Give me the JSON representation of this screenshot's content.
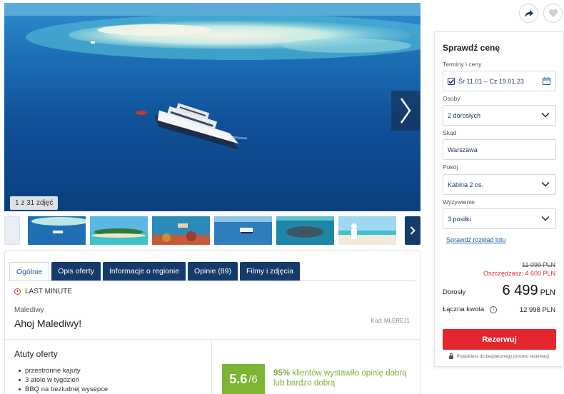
{
  "gallery": {
    "counter": "1 z 31 zdjęć",
    "thumbnails": [
      "boat-aerial",
      "island-beach",
      "snorkeling",
      "boat-sea",
      "dolphin",
      "woman-beach"
    ]
  },
  "tabs": [
    {
      "label": "Ogólnie",
      "active": true
    },
    {
      "label": "Opis oferty"
    },
    {
      "label": "Informacje o regionie"
    },
    {
      "label": "Opinie (89)"
    },
    {
      "label": "Filmy i zdjęcia"
    }
  ],
  "offer": {
    "badge": "LAST MINUTE",
    "region": "Malediwy",
    "title": "Ahoj Malediwy!",
    "code": "Kod: MLEREJ1"
  },
  "atuty": {
    "title": "Atuty oferty",
    "items": [
      "przestronne kajuty",
      "3 atole w tygdzień",
      "BBQ na bezludnej wysepce"
    ]
  },
  "rating": {
    "score": "5.6",
    "scale": "/6",
    "percent": "95%",
    "text": "klientów wystawiło opinię dobrą lub bardzo dobrą"
  },
  "booking": {
    "title": "Sprawdź cenę",
    "dates_label": "Terminy i ceny",
    "dates_value": "Śr 11.01 – Cz 19.01.23",
    "persons_label": "Osoby",
    "persons_value": "2 dorosłych",
    "from_label": "Skąd",
    "from_value": "Warszawa",
    "room_label": "Pokój",
    "room_value": "Kabina 2 os.",
    "board_label": "Wyżywienie",
    "board_value": "3 posiłki",
    "schedule_link": "Sprawdź rozkład lotu",
    "old_price": "11 099 PLN",
    "savings": "Oszczędzasz: 4 600 PLN",
    "adults_label": "Dorosły",
    "price": "6 499",
    "currency": "PLN",
    "total_label": "Łączna kwota",
    "total_value": "12 998 PLN",
    "reserve_label": "Rezerwuj",
    "secure_note": "Przejdziesz do bezpiecznego procesu rezerwacji"
  },
  "colors": {
    "navy": "#153b6b",
    "accent_blue": "#1e5ba8",
    "red": "#e4272f",
    "green": "#7cb433"
  }
}
